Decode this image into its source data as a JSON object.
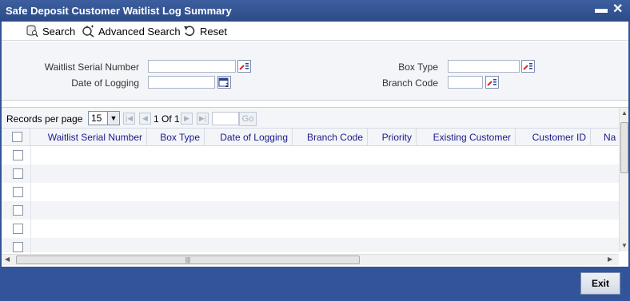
{
  "window": {
    "title": "Safe Deposit Customer Waitlist Log Summary"
  },
  "toolbar": {
    "search": "Search",
    "advanced_search": "Advanced Search",
    "reset": "Reset"
  },
  "criteria": {
    "waitlist_serial_number": "Waitlist Serial Number",
    "date_of_logging": "Date of Logging",
    "box_type": "Box Type",
    "branch_code": "Branch Code"
  },
  "pager": {
    "records_label": "Records per page",
    "page_size": "15",
    "page_info": "1 Of 1",
    "go": "Go"
  },
  "columns": [
    "Waitlist Serial Number",
    "Box Type",
    "Date of Logging",
    "Branch Code",
    "Priority",
    "Existing Customer",
    "Customer ID",
    "Na"
  ],
  "footer": {
    "exit": "Exit"
  },
  "colors": {
    "frame": "#32559a",
    "header_text": "#1a1a8c",
    "panel": "#f3f5f8"
  }
}
